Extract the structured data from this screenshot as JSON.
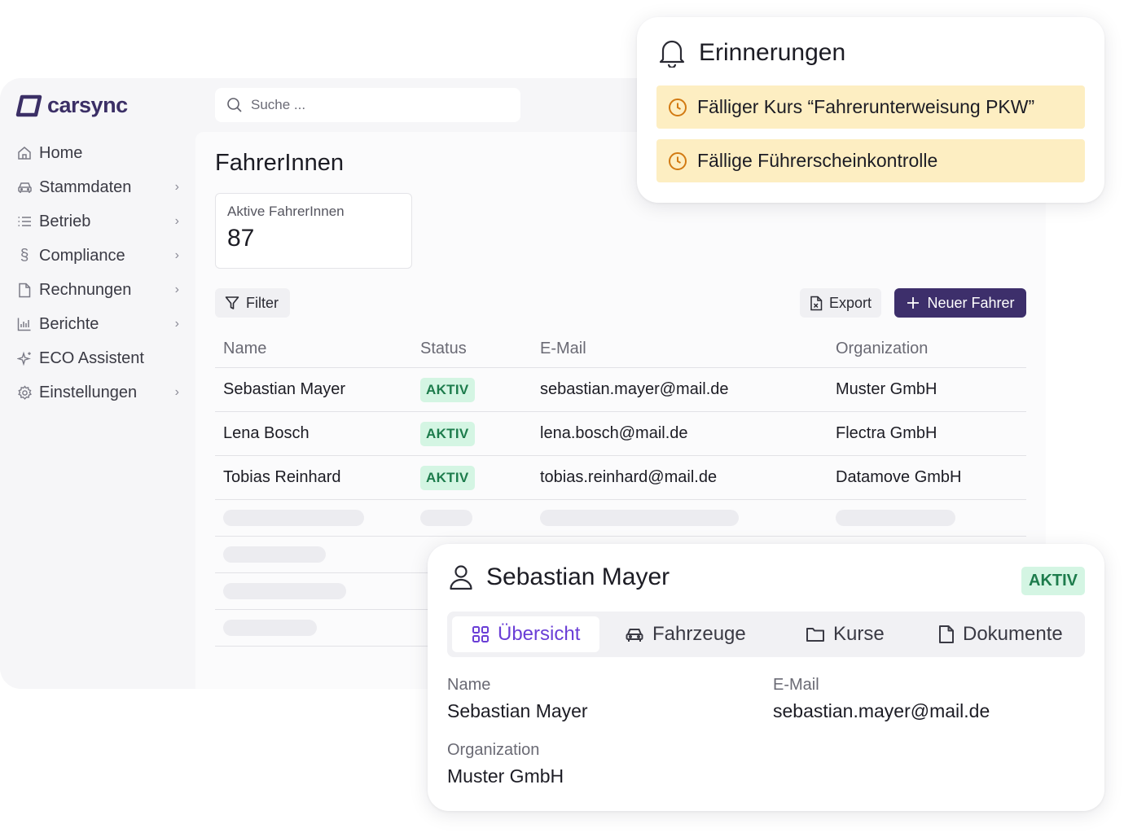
{
  "app": {
    "logo_text": "carsync",
    "brand_color": "#3b2f66",
    "search_placeholder": "Suche ...",
    "nav": [
      {
        "label": "Home",
        "icon": "home-icon",
        "has_children": false
      },
      {
        "label": "Stammdaten",
        "icon": "car-icon",
        "has_children": true
      },
      {
        "label": "Betrieb",
        "icon": "list-icon",
        "has_children": true
      },
      {
        "label": "Compliance",
        "icon": "section-icon",
        "has_children": true
      },
      {
        "label": "Rechnungen",
        "icon": "file-icon",
        "has_children": true
      },
      {
        "label": "Berichte",
        "icon": "bar-chart-icon",
        "has_children": true
      },
      {
        "label": "ECO Assistent",
        "icon": "sparkle-icon",
        "has_children": false
      },
      {
        "label": "Einstellungen",
        "icon": "gear-icon",
        "has_children": true
      }
    ]
  },
  "page": {
    "title": "FahrerInnen",
    "stat": {
      "label": "Aktive FahrerInnen",
      "value": "87"
    },
    "filter_label": "Filter",
    "export_label": "Export",
    "new_label": "Neuer Fahrer",
    "table": {
      "headers": [
        "Name",
        "Status",
        "E-Mail",
        "Organization"
      ],
      "rows": [
        {
          "name": "Sebastian Mayer",
          "status": "AKTIV",
          "email": "sebastian.mayer@mail.de",
          "org": "Muster GmbH"
        },
        {
          "name": "Lena Bosch",
          "status": "AKTIV",
          "email": "lena.bosch@mail.de",
          "org": "Flectra GmbH"
        },
        {
          "name": "Tobias Reinhard",
          "status": "AKTIV",
          "email": "tobias.reinhard@mail.de",
          "org": "Datamove GmbH"
        }
      ]
    }
  },
  "reminders": {
    "title": "Erinnerungen",
    "items": [
      "Fälliger Kurs “Fahrerunterweisung PKW”",
      "Fällige Führerscheinkontrolle"
    ],
    "highlight_color": "#fdeec2"
  },
  "detail": {
    "name": "Sebastian Mayer",
    "status": "AKTIV",
    "tabs": [
      {
        "label": "Übersicht",
        "icon": "grid-icon",
        "active": true
      },
      {
        "label": "Fahrzeuge",
        "icon": "car-icon",
        "active": false
      },
      {
        "label": "Kurse",
        "icon": "folder-icon",
        "active": false
      },
      {
        "label": "Dokumente",
        "icon": "document-icon",
        "active": false
      }
    ],
    "fields": {
      "name_label": "Name",
      "name_value": "Sebastian Mayer",
      "email_label": "E-Mail",
      "email_value": "sebastian.mayer@mail.de",
      "org_label": "Organization",
      "org_value": "Muster GmbH"
    },
    "accent_color": "#6a3ed6"
  }
}
